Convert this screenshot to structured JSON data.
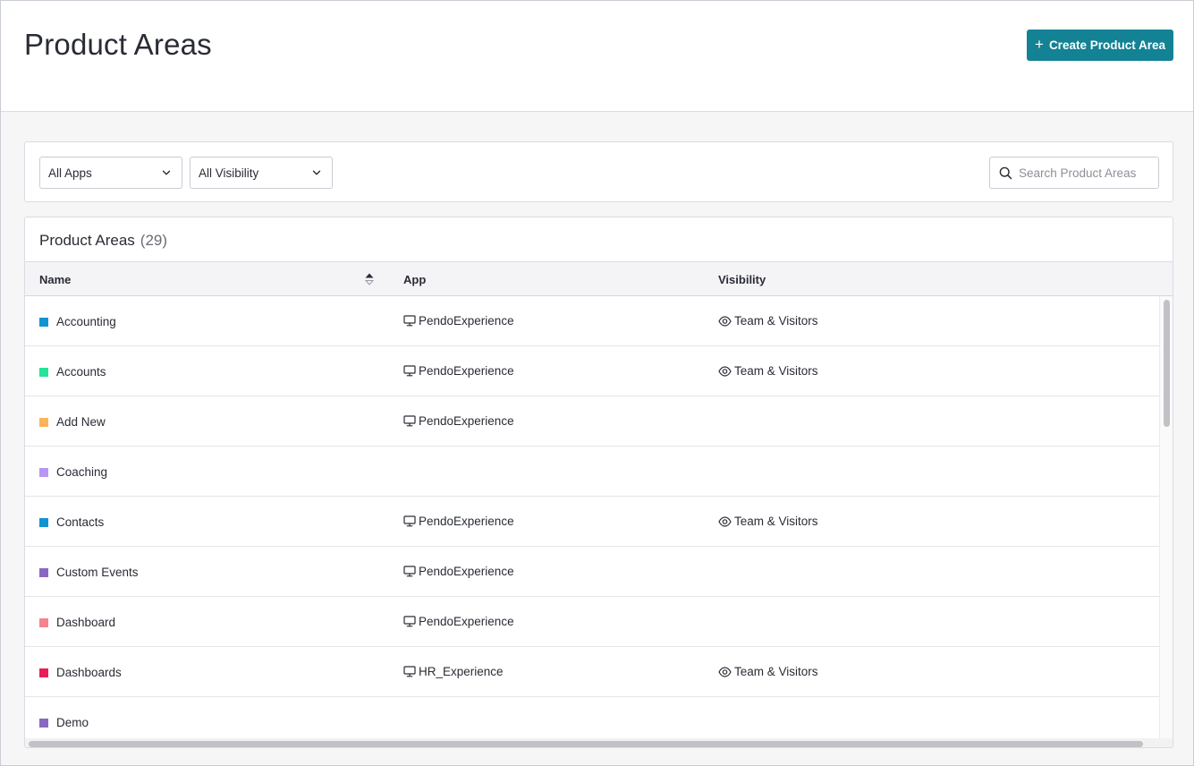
{
  "header": {
    "title": "Product Areas",
    "create_button_label": "Create Product Area",
    "create_button_icon": "plus-icon",
    "accent_color": "#128294"
  },
  "filters": {
    "app_filter": "All Apps",
    "visibility_filter": "All Visibility",
    "search_placeholder": "Search Product Areas",
    "search_value": ""
  },
  "table": {
    "title": "Product Areas",
    "count": "(29)",
    "columns": {
      "name": "Name",
      "app": "App",
      "visibility": "Visibility"
    },
    "sort": {
      "column": "Name",
      "direction": "ascending"
    },
    "rows": [
      {
        "name": "Accounting",
        "color": "#0f94d2",
        "app": "PendoExperience",
        "visibility": "Team & Visitors"
      },
      {
        "name": "Accounts",
        "color": "#25e39a",
        "app": "PendoExperience",
        "visibility": "Team & Visitors"
      },
      {
        "name": "Add New",
        "color": "#fcb35a",
        "app": "PendoExperience",
        "visibility": ""
      },
      {
        "name": "Coaching",
        "color": "#b895f7",
        "app": "",
        "visibility": ""
      },
      {
        "name": "Contacts",
        "color": "#0f94d2",
        "app": "PendoExperience",
        "visibility": "Team & Visitors"
      },
      {
        "name": "Custom Events",
        "color": "#8a67c2",
        "app": "PendoExperience",
        "visibility": ""
      },
      {
        "name": "Dashboard",
        "color": "#f6828f",
        "app": "PendoExperience",
        "visibility": ""
      },
      {
        "name": "Dashboards",
        "color": "#ea1c57",
        "app": "HR_Experience",
        "visibility": "Team & Visitors"
      },
      {
        "name": "Demo",
        "color": "#8a67c2",
        "app": "",
        "visibility": ""
      }
    ]
  }
}
